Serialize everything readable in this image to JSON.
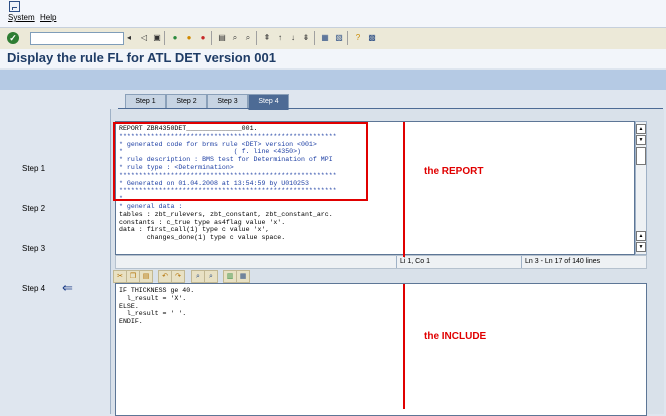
{
  "menu": {
    "items": [
      "System",
      "Help"
    ]
  },
  "toolbar": {
    "command_value": "",
    "icons": [
      "enter-icon",
      "save-icon",
      "back-icon",
      "exit-icon",
      "cancel-icon",
      "print-icon",
      "find-icon",
      "find-next-icon",
      "first-page-icon",
      "previous-page-icon",
      "next-page-icon",
      "last-page-icon",
      "create-session-icon",
      "shortcut-icon",
      "help-icon",
      "layout-icon"
    ]
  },
  "title": "Display the rule FL for ATL DET version 001",
  "tabs": [
    "Step 1",
    "Step 2",
    "Step 3",
    "Step 4"
  ],
  "active_tab": "Step 4",
  "steps_left": [
    "Step 1",
    "Step 2",
    "Step 3",
    "Step 4"
  ],
  "report_code": [
    {
      "text": "REPORT ZBR4350DET______________001.",
      "color": "black"
    },
    {
      "text": "*******************************************************",
      "color": "blue"
    },
    {
      "text": "* generated code for brms rule <DET> version <001>",
      "color": "blue"
    },
    {
      "text": "*                            ( f. line <4350>)",
      "color": "blue"
    },
    {
      "text": "* rule description : BMS test for Determination of MPI",
      "color": "blue"
    },
    {
      "text": "* rule type : <Determination>",
      "color": "blue"
    },
    {
      "text": "*******************************************************",
      "color": "blue"
    },
    {
      "text": "* Generated on 01.04.2008 at 13:54:59 by U010253",
      "color": "blue"
    },
    {
      "text": "*******************************************************",
      "color": "blue"
    },
    {
      "text": "*",
      "color": "blue"
    },
    {
      "text": "* general data :",
      "color": "blue"
    },
    {
      "text": "tables : zbt_rulevers, zbt_constant, zbt_constant_arc.",
      "color": "black"
    },
    {
      "text": "constants : c_true type as4flag value 'x'.",
      "color": "black"
    },
    {
      "text": "data : first_call(1) type c value 'x',",
      "color": "black"
    },
    {
      "text": "       changes_done(1) type c value space.",
      "color": "black"
    }
  ],
  "status": {
    "position": "Li 1, Co 1",
    "lines": "Ln 3 - Ln 17 of 140 lines"
  },
  "include_code": [
    "IF THICKNESS ge 40.",
    "  l_result = 'X'.",
    "ELSE.",
    "  l_result = ' '.",
    "ENDIF."
  ],
  "annotations": {
    "report_label": "the REPORT",
    "include_label": "the INCLUDE",
    "color": "#e00000"
  }
}
